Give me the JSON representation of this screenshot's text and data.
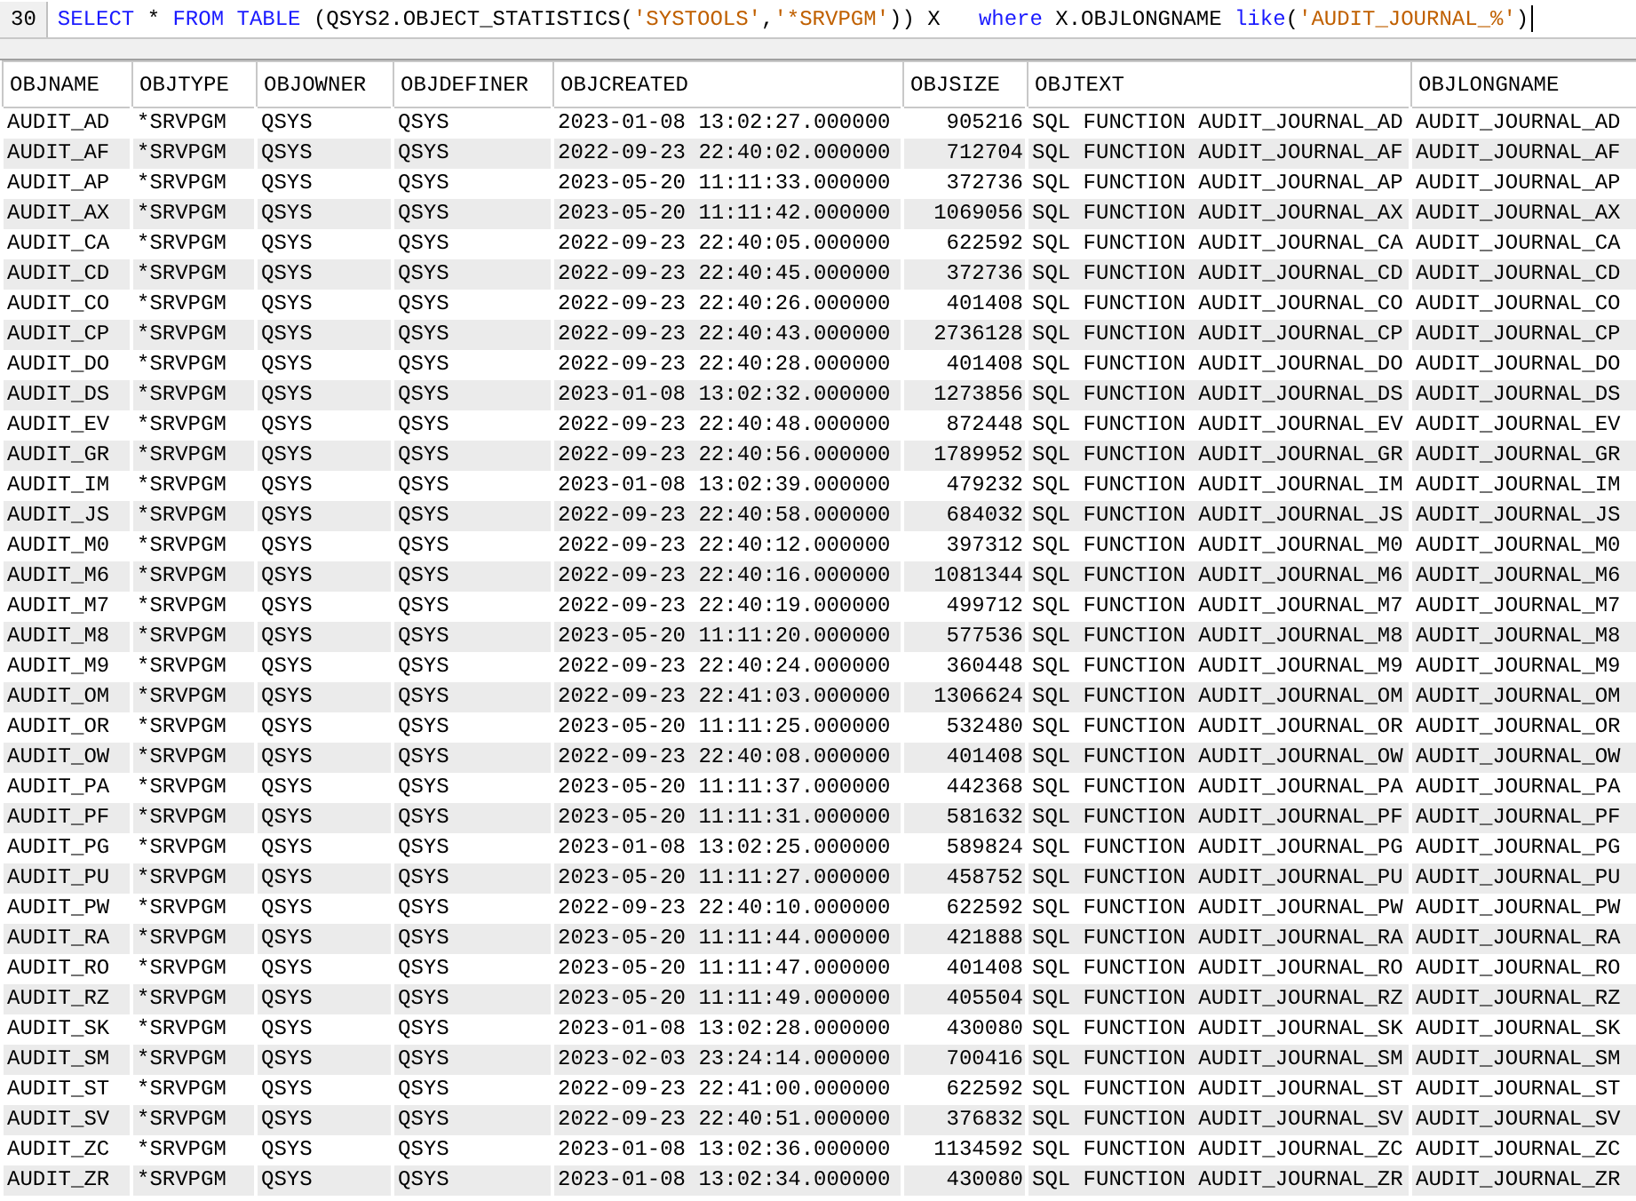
{
  "editor": {
    "line_number": "30",
    "tokens": [
      {
        "text": "SELECT",
        "kind": "keyword"
      },
      {
        "text": " * ",
        "kind": "plain"
      },
      {
        "text": "FROM TABLE",
        "kind": "keyword"
      },
      {
        "text": " (QSYS2.OBJECT_STATISTICS(",
        "kind": "plain"
      },
      {
        "text": "'SYSTOOLS'",
        "kind": "string"
      },
      {
        "text": ",",
        "kind": "plain"
      },
      {
        "text": "'*SRVPGM'",
        "kind": "string"
      },
      {
        "text": ")) X   ",
        "kind": "plain"
      },
      {
        "text": "where",
        "kind": "keyword"
      },
      {
        "text": " X.OBJLONGNAME ",
        "kind": "plain"
      },
      {
        "text": "like",
        "kind": "keyword"
      },
      {
        "text": "(",
        "kind": "plain"
      },
      {
        "text": "'AUDIT_JOURNAL_%'",
        "kind": "string"
      },
      {
        "text": ")",
        "kind": "plain"
      }
    ]
  },
  "table": {
    "columns": [
      "OBJNAME",
      "OBJTYPE",
      "OBJOWNER",
      "OBJDEFINER",
      "OBJCREATED",
      "OBJSIZE",
      "OBJTEXT",
      "OBJLONGNAME"
    ],
    "rows": [
      [
        "AUDIT_AD",
        "*SRVPGM",
        "QSYS",
        "QSYS",
        "2023-01-08 13:02:27.000000",
        "905216",
        "SQL FUNCTION AUDIT_JOURNAL_AD",
        "AUDIT_JOURNAL_AD"
      ],
      [
        "AUDIT_AF",
        "*SRVPGM",
        "QSYS",
        "QSYS",
        "2022-09-23 22:40:02.000000",
        "712704",
        "SQL FUNCTION AUDIT_JOURNAL_AF",
        "AUDIT_JOURNAL_AF"
      ],
      [
        "AUDIT_AP",
        "*SRVPGM",
        "QSYS",
        "QSYS",
        "2023-05-20 11:11:33.000000",
        "372736",
        "SQL FUNCTION AUDIT_JOURNAL_AP",
        "AUDIT_JOURNAL_AP"
      ],
      [
        "AUDIT_AX",
        "*SRVPGM",
        "QSYS",
        "QSYS",
        "2023-05-20 11:11:42.000000",
        "1069056",
        "SQL FUNCTION AUDIT_JOURNAL_AX",
        "AUDIT_JOURNAL_AX"
      ],
      [
        "AUDIT_CA",
        "*SRVPGM",
        "QSYS",
        "QSYS",
        "2022-09-23 22:40:05.000000",
        "622592",
        "SQL FUNCTION AUDIT_JOURNAL_CA",
        "AUDIT_JOURNAL_CA"
      ],
      [
        "AUDIT_CD",
        "*SRVPGM",
        "QSYS",
        "QSYS",
        "2022-09-23 22:40:45.000000",
        "372736",
        "SQL FUNCTION AUDIT_JOURNAL_CD",
        "AUDIT_JOURNAL_CD"
      ],
      [
        "AUDIT_CO",
        "*SRVPGM",
        "QSYS",
        "QSYS",
        "2022-09-23 22:40:26.000000",
        "401408",
        "SQL FUNCTION AUDIT_JOURNAL_CO",
        "AUDIT_JOURNAL_CO"
      ],
      [
        "AUDIT_CP",
        "*SRVPGM",
        "QSYS",
        "QSYS",
        "2022-09-23 22:40:43.000000",
        "2736128",
        "SQL FUNCTION AUDIT_JOURNAL_CP",
        "AUDIT_JOURNAL_CP"
      ],
      [
        "AUDIT_DO",
        "*SRVPGM",
        "QSYS",
        "QSYS",
        "2022-09-23 22:40:28.000000",
        "401408",
        "SQL FUNCTION AUDIT_JOURNAL_DO",
        "AUDIT_JOURNAL_DO"
      ],
      [
        "AUDIT_DS",
        "*SRVPGM",
        "QSYS",
        "QSYS",
        "2023-01-08 13:02:32.000000",
        "1273856",
        "SQL FUNCTION AUDIT_JOURNAL_DS",
        "AUDIT_JOURNAL_DS"
      ],
      [
        "AUDIT_EV",
        "*SRVPGM",
        "QSYS",
        "QSYS",
        "2022-09-23 22:40:48.000000",
        "872448",
        "SQL FUNCTION AUDIT_JOURNAL_EV",
        "AUDIT_JOURNAL_EV"
      ],
      [
        "AUDIT_GR",
        "*SRVPGM",
        "QSYS",
        "QSYS",
        "2022-09-23 22:40:56.000000",
        "1789952",
        "SQL FUNCTION AUDIT_JOURNAL_GR",
        "AUDIT_JOURNAL_GR"
      ],
      [
        "AUDIT_IM",
        "*SRVPGM",
        "QSYS",
        "QSYS",
        "2023-01-08 13:02:39.000000",
        "479232",
        "SQL FUNCTION AUDIT_JOURNAL_IM",
        "AUDIT_JOURNAL_IM"
      ],
      [
        "AUDIT_JS",
        "*SRVPGM",
        "QSYS",
        "QSYS",
        "2022-09-23 22:40:58.000000",
        "684032",
        "SQL FUNCTION AUDIT_JOURNAL_JS",
        "AUDIT_JOURNAL_JS"
      ],
      [
        "AUDIT_M0",
        "*SRVPGM",
        "QSYS",
        "QSYS",
        "2022-09-23 22:40:12.000000",
        "397312",
        "SQL FUNCTION AUDIT_JOURNAL_M0",
        "AUDIT_JOURNAL_M0"
      ],
      [
        "AUDIT_M6",
        "*SRVPGM",
        "QSYS",
        "QSYS",
        "2022-09-23 22:40:16.000000",
        "1081344",
        "SQL FUNCTION AUDIT_JOURNAL_M6",
        "AUDIT_JOURNAL_M6"
      ],
      [
        "AUDIT_M7",
        "*SRVPGM",
        "QSYS",
        "QSYS",
        "2022-09-23 22:40:19.000000",
        "499712",
        "SQL FUNCTION AUDIT_JOURNAL_M7",
        "AUDIT_JOURNAL_M7"
      ],
      [
        "AUDIT_M8",
        "*SRVPGM",
        "QSYS",
        "QSYS",
        "2023-05-20 11:11:20.000000",
        "577536",
        "SQL FUNCTION AUDIT_JOURNAL_M8",
        "AUDIT_JOURNAL_M8"
      ],
      [
        "AUDIT_M9",
        "*SRVPGM",
        "QSYS",
        "QSYS",
        "2022-09-23 22:40:24.000000",
        "360448",
        "SQL FUNCTION AUDIT_JOURNAL_M9",
        "AUDIT_JOURNAL_M9"
      ],
      [
        "AUDIT_OM",
        "*SRVPGM",
        "QSYS",
        "QSYS",
        "2022-09-23 22:41:03.000000",
        "1306624",
        "SQL FUNCTION AUDIT_JOURNAL_OM",
        "AUDIT_JOURNAL_OM"
      ],
      [
        "AUDIT_OR",
        "*SRVPGM",
        "QSYS",
        "QSYS",
        "2023-05-20 11:11:25.000000",
        "532480",
        "SQL FUNCTION AUDIT_JOURNAL_OR",
        "AUDIT_JOURNAL_OR"
      ],
      [
        "AUDIT_OW",
        "*SRVPGM",
        "QSYS",
        "QSYS",
        "2022-09-23 22:40:08.000000",
        "401408",
        "SQL FUNCTION AUDIT_JOURNAL_OW",
        "AUDIT_JOURNAL_OW"
      ],
      [
        "AUDIT_PA",
        "*SRVPGM",
        "QSYS",
        "QSYS",
        "2023-05-20 11:11:37.000000",
        "442368",
        "SQL FUNCTION AUDIT_JOURNAL_PA",
        "AUDIT_JOURNAL_PA"
      ],
      [
        "AUDIT_PF",
        "*SRVPGM",
        "QSYS",
        "QSYS",
        "2023-05-20 11:11:31.000000",
        "581632",
        "SQL FUNCTION AUDIT_JOURNAL_PF",
        "AUDIT_JOURNAL_PF"
      ],
      [
        "AUDIT_PG",
        "*SRVPGM",
        "QSYS",
        "QSYS",
        "2023-01-08 13:02:25.000000",
        "589824",
        "SQL FUNCTION AUDIT_JOURNAL_PG",
        "AUDIT_JOURNAL_PG"
      ],
      [
        "AUDIT_PU",
        "*SRVPGM",
        "QSYS",
        "QSYS",
        "2023-05-20 11:11:27.000000",
        "458752",
        "SQL FUNCTION AUDIT_JOURNAL_PU",
        "AUDIT_JOURNAL_PU"
      ],
      [
        "AUDIT_PW",
        "*SRVPGM",
        "QSYS",
        "QSYS",
        "2022-09-23 22:40:10.000000",
        "622592",
        "SQL FUNCTION AUDIT_JOURNAL_PW",
        "AUDIT_JOURNAL_PW"
      ],
      [
        "AUDIT_RA",
        "*SRVPGM",
        "QSYS",
        "QSYS",
        "2023-05-20 11:11:44.000000",
        "421888",
        "SQL FUNCTION AUDIT_JOURNAL_RA",
        "AUDIT_JOURNAL_RA"
      ],
      [
        "AUDIT_RO",
        "*SRVPGM",
        "QSYS",
        "QSYS",
        "2023-05-20 11:11:47.000000",
        "401408",
        "SQL FUNCTION AUDIT_JOURNAL_RO",
        "AUDIT_JOURNAL_RO"
      ],
      [
        "AUDIT_RZ",
        "*SRVPGM",
        "QSYS",
        "QSYS",
        "2023-05-20 11:11:49.000000",
        "405504",
        "SQL FUNCTION AUDIT_JOURNAL_RZ",
        "AUDIT_JOURNAL_RZ"
      ],
      [
        "AUDIT_SK",
        "*SRVPGM",
        "QSYS",
        "QSYS",
        "2023-01-08 13:02:28.000000",
        "430080",
        "SQL FUNCTION AUDIT_JOURNAL_SK",
        "AUDIT_JOURNAL_SK"
      ],
      [
        "AUDIT_SM",
        "*SRVPGM",
        "QSYS",
        "QSYS",
        "2023-02-03 23:24:14.000000",
        "700416",
        "SQL FUNCTION AUDIT_JOURNAL_SM",
        "AUDIT_JOURNAL_SM"
      ],
      [
        "AUDIT_ST",
        "*SRVPGM",
        "QSYS",
        "QSYS",
        "2022-09-23 22:41:00.000000",
        "622592",
        "SQL FUNCTION AUDIT_JOURNAL_ST",
        "AUDIT_JOURNAL_ST"
      ],
      [
        "AUDIT_SV",
        "*SRVPGM",
        "QSYS",
        "QSYS",
        "2022-09-23 22:40:51.000000",
        "376832",
        "SQL FUNCTION AUDIT_JOURNAL_SV",
        "AUDIT_JOURNAL_SV"
      ],
      [
        "AUDIT_ZC",
        "*SRVPGM",
        "QSYS",
        "QSYS",
        "2023-01-08 13:02:36.000000",
        "1134592",
        "SQL FUNCTION AUDIT_JOURNAL_ZC",
        "AUDIT_JOURNAL_ZC"
      ],
      [
        "AUDIT_ZR",
        "*SRVPGM",
        "QSYS",
        "QSYS",
        "2023-01-08 13:02:34.000000",
        "430080",
        "SQL FUNCTION AUDIT_JOURNAL_ZR",
        "AUDIT_JOURNAL_ZR"
      ]
    ]
  }
}
